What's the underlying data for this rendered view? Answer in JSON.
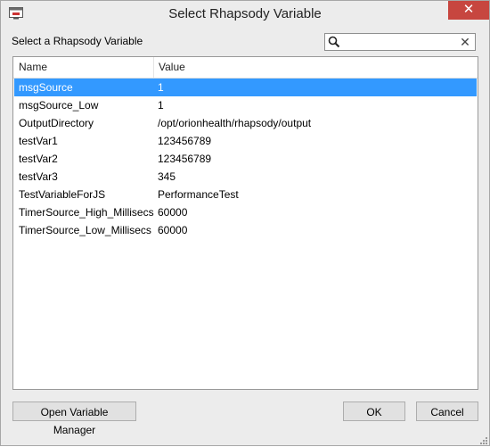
{
  "window": {
    "title": "Select Rhapsody Variable",
    "close_glyph": "✕",
    "icon": "app-icon"
  },
  "label": "Select a Rhapsody Variable",
  "search": {
    "value": "",
    "placeholder": "",
    "icon": "search-icon",
    "clear_glyph": "✕"
  },
  "list": {
    "columns": [
      "Name",
      "Value"
    ],
    "selected_index": 0,
    "rows": [
      {
        "name": "msgSource",
        "value": "1"
      },
      {
        "name": "msgSource_Low",
        "value": "1"
      },
      {
        "name": "OutputDirectory",
        "value": "/opt/orionhealth/rhapsody/output"
      },
      {
        "name": "testVar1",
        "value": "123456789"
      },
      {
        "name": "testVar2",
        "value": "123456789"
      },
      {
        "name": "testVar3",
        "value": "345"
      },
      {
        "name": "TestVariableForJS",
        "value": "PerformanceTest"
      },
      {
        "name": "TimerSource_High_Millisecs",
        "value": "60000"
      },
      {
        "name": "TimerSource_Low_Millisecs",
        "value": "60000"
      }
    ]
  },
  "buttons": {
    "open_variable_manager": "Open Variable Manager",
    "ok": "OK",
    "cancel": "Cancel"
  },
  "colors": {
    "selection": "#3399ff",
    "close": "#c7463f"
  }
}
